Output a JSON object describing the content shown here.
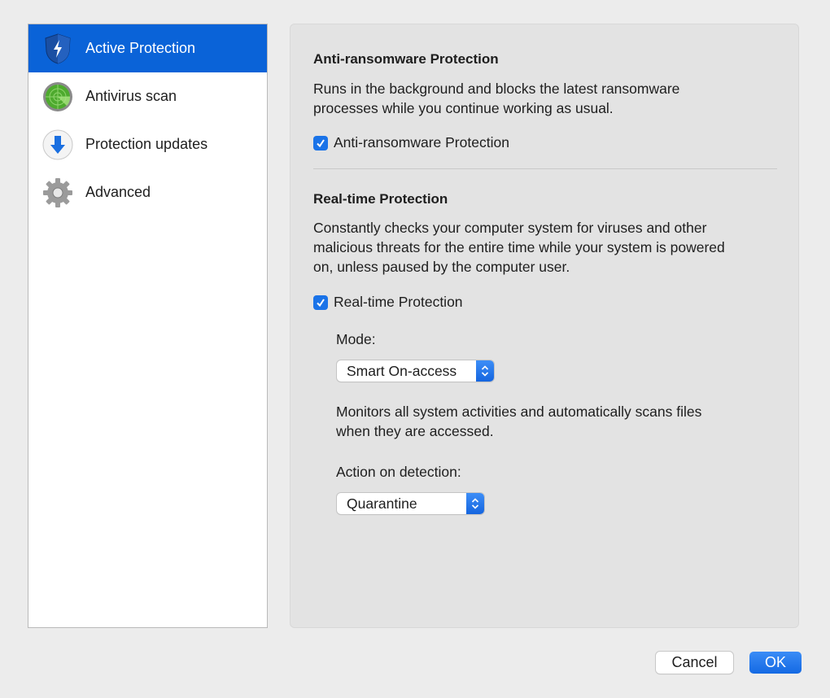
{
  "sidebar": {
    "items": [
      {
        "label": "Active Protection",
        "icon": "shield-bolt-icon",
        "active": true
      },
      {
        "label": "Antivirus scan",
        "icon": "radar-icon",
        "active": false
      },
      {
        "label": "Protection updates",
        "icon": "download-arrow-icon",
        "active": false
      },
      {
        "label": "Advanced",
        "icon": "gear-icon",
        "active": false
      }
    ]
  },
  "anti_ransomware": {
    "title": "Anti-ransomware Protection",
    "description_line1": "Runs in the background and blocks the latest ransomware",
    "description_line2": "processes while you continue working as usual.",
    "checkbox_label": "Anti-ransomware Protection",
    "checked": true
  },
  "realtime": {
    "title": "Real-time Protection",
    "description_line1": "Constantly checks your computer system for viruses and other",
    "description_line2": "malicious threats for the entire time while your system is powered",
    "description_line3": "on, unless paused by the computer user.",
    "checkbox_label": "Real-time Protection",
    "checked": true,
    "mode_label": "Mode:",
    "mode_value": "Smart On-access",
    "mode_description_line1": "Monitors all system activities and automatically scans files",
    "mode_description_line2": "when they are accessed.",
    "action_label": "Action on detection:",
    "action_value": "Quarantine"
  },
  "buttons": {
    "cancel": "Cancel",
    "ok": "OK"
  },
  "colors": {
    "accent": "#0a63d8",
    "panel_bg": "#e3e3e3",
    "window_bg": "#ececec"
  }
}
